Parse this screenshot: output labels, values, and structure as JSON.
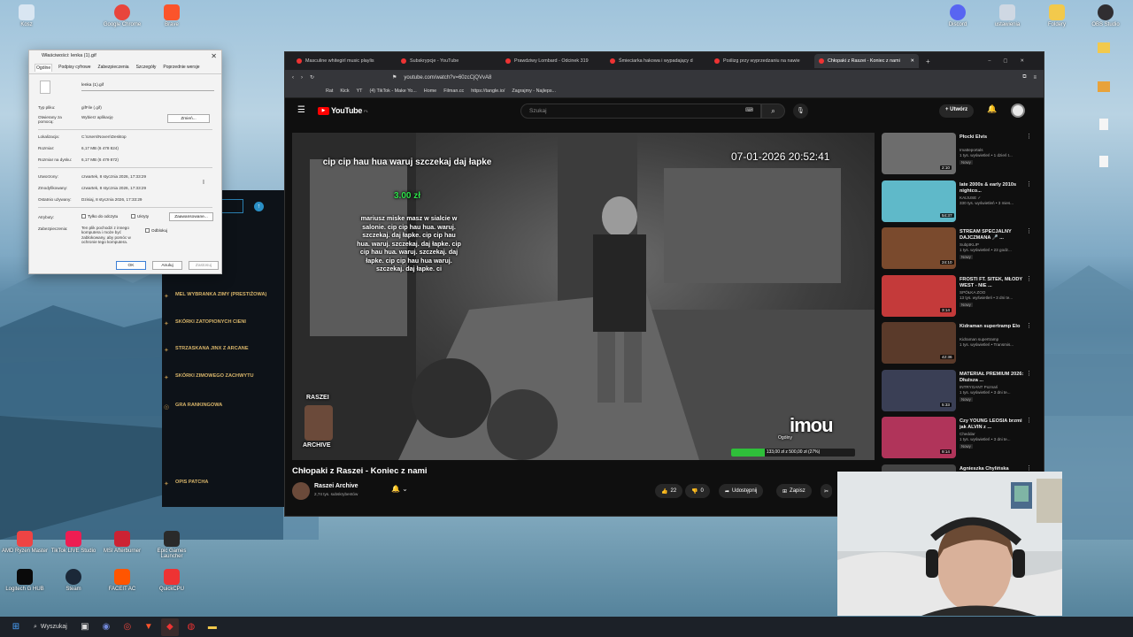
{
  "desktop": {
    "icons_left": [
      {
        "label": "Kosz",
        "color": "#d9e6f2"
      },
      {
        "label": "Google Chrome",
        "color": "#e8453c"
      },
      {
        "label": "Brave",
        "color": "#fb542b"
      }
    ],
    "icons_right": [
      {
        "label": "Discord",
        "color": "#5865f2"
      },
      {
        "label": "ustawienia",
        "color": "#cfd8e3"
      },
      {
        "label": "Foldery",
        "color": "#f2c94c"
      },
      {
        "label": "OBS Studio",
        "color": "#302e31"
      }
    ],
    "icons_bottom": [
      {
        "label": "AMD Ryzen Master",
        "color": "#e44"
      },
      {
        "label": "TikTok LIVE Studio",
        "color": "#ee1d52"
      },
      {
        "label": "MSI Afterburner",
        "color": "#c23"
      },
      {
        "label": "Epic Games Launcher",
        "color": "#2a2a2a"
      },
      {
        "label": "Logitech G HUB",
        "color": "#0a0a0a"
      },
      {
        "label": "Steam",
        "color": "#1b2838"
      },
      {
        "label": "FACEIT AC",
        "color": "#ff5500"
      },
      {
        "label": "QuickCPU",
        "color": "#e33"
      }
    ]
  },
  "taskbar": {
    "search_label": "Wyszukaj"
  },
  "properties_dialog": {
    "title": "Właściwości: lenka (1).gif",
    "close": "✕",
    "tabs": [
      "Ogólne",
      "Podpisy cyfrowe",
      "Zabezpieczenia",
      "Szczegóły",
      "Poprzednie wersje"
    ],
    "filename": "lenka (1).gif",
    "rows": [
      {
        "label": "Typ pliku:",
        "value": "gifFile (.gif)"
      },
      {
        "label": "Otwierany za pomocą:",
        "value": "Wybierz aplikację"
      },
      {
        "label": "Lokalizacja:",
        "value": "C:\\Users\\Noven\\Desktop"
      },
      {
        "label": "Rozmiar:",
        "value": "6,17 MB (6 478 824)"
      },
      {
        "label": "Rozmiar na dysku:",
        "value": "6,17 MB (6 479 872)"
      },
      {
        "label": "Utworzony:",
        "value": "czwartek, 8 stycznia 2026, 17:33:29"
      },
      {
        "label": "Zmodyfikowany:",
        "value": "czwartek, 8 stycznia 2026, 17:33:29"
      },
      {
        "label": "Ostatnio używany:",
        "value": "Dzisiaj, 8 stycznia 2026, 17:33:29"
      },
      {
        "label": "Atrybuty:",
        "value": ""
      },
      {
        "label": "Zabezpieczenia:",
        "value": "Ten plik pochodzi z innego komputera i może być zablokowany, aby pomóc w ochronie tego komputera."
      }
    ],
    "change_button": "Zmień...",
    "readonly_label": "Tylko do odczytu",
    "hidden_label": "Ukryty",
    "advanced_button": "Zaawansowane...",
    "unblock_label": "Odblokuj",
    "ok": "OK",
    "cancel": "Anuluj",
    "apply": "Zastosuj"
  },
  "launcher": {
    "menu": [
      "MEL WYBRANKA ZIMY (PRESTIŻOWA)",
      "SKÓRKI ZATOPIONYCH CIENI",
      "STRZASKANA JINX Z ARCANE",
      "SKÓRKI ZIMOWEGO ZACHWYTU",
      "GRA RANKINGOWA"
    ],
    "patch": "OPIS PATCHA"
  },
  "browser": {
    "tabs": [
      {
        "label": "Masculine whitegirl music playlis",
        "active": false
      },
      {
        "label": "Subskrypcje - YouTube",
        "active": false
      },
      {
        "label": "Prawdziwy Lombard - Odcinek 319",
        "active": false
      },
      {
        "label": "Śmieciarka hakowa i wypadający d",
        "active": false
      },
      {
        "label": "Poślizg przy wyprzedzaniu na nawie",
        "active": false
      },
      {
        "label": "Chłopaki z Raszei - Koniec z nami",
        "active": true
      }
    ],
    "new_tab": "+",
    "url": "youtube.com/watch?v=60zcCjQVvA8",
    "bookmarks": [
      "Rat",
      "Kick",
      "YT",
      "(4) TikTok - Make Yo...",
      "Home",
      "Filman.cc",
      "https://tangle.io/",
      "Zagrajmy - Najleps..."
    ]
  },
  "youtube": {
    "logo_text": "YouTube",
    "logo_region": "PL",
    "search_placeholder": "Szukaj",
    "create_label": "Utwórz",
    "video": {
      "overlay_title": "cip cip hau hua waruj szczekaj daj łapke",
      "overlay_amount": "3.00 zł",
      "overlay_message": "mariusz miske masz w sialcie w salonie. cip cip hau hua. waruj. szczekaj. daj łapke. cip cip hau hua. waruj. szczekaj. daj łapke. cip cip hau hua. waruj. szczekaj. daj łapke. cip cip hau hua waruj. szczekaj. daj łapke. ci",
      "timestamp": "07-01-2026 20:52:41",
      "watermark": "imou",
      "badge_name": "RASZEI",
      "badge_archive": "ARCHIVE",
      "goal_label": "Ogólny",
      "goal_text": "133,00 zł z 500,00 zł (27%)",
      "goal_fraction": 0.27
    },
    "title": "Chłopaki z Raszei - Koniec z nami",
    "channel": "Raszei Archive",
    "subscribers": "2,74 tys. subskrybentów",
    "likes": "22",
    "dislikes": "0",
    "share": "Udostępnij",
    "save": "Zapisz",
    "recommended": [
      {
        "title": "Płocki Elvis",
        "channel": "Imatteportals",
        "meta": "1 tys. wyświetleń • 1 dzień t...",
        "badge": "Nowy",
        "duration": "2:10",
        "color": "#6d6d6d"
      },
      {
        "title": "late 2000s & early 2010s nightco...",
        "channel": "KAIJUSE ✓",
        "meta": "330 tys. wyświetleń • 3 mies...",
        "badge": "",
        "duration": "54:37",
        "color": "#5fb9c9"
      },
      {
        "title": "STREAM SPECJALNY DAJCZMANA 🎤 ...",
        "channel": "SubptKLIP",
        "meta": "1 tys. wyświetleń • 23 godz...",
        "badge": "Nowy",
        "duration": "24:10",
        "color": "#7a4a2d"
      },
      {
        "title": "FROSTI FT. SITEK, MŁODY WEST - NIE ...",
        "channel": "SPÓŁKA ZOO",
        "meta": "13 tys. wyświetleń • 3 dni te...",
        "badge": "Nowy",
        "duration": "3:14",
        "color": "#c43a3a"
      },
      {
        "title": "Kidraman supertramp Elo",
        "channel": "Kidraman supertramp",
        "meta": "1 tys. wyświetleń • Transmis...",
        "badge": "",
        "duration": "42:36",
        "color": "#5a3a2a"
      },
      {
        "title": "MATERIAŁ PREMIUM 2026: Dłuższa ...",
        "channel": "INTRYGANT Poznań",
        "meta": "1 tys. wyświetleń • 3 dni te...",
        "badge": "Nowy",
        "duration": "5:33",
        "color": "#3a3f55"
      },
      {
        "title": "Czy YOUNG LEOSIA brzmi jak ALVIN z ...",
        "channel": "Cheddar",
        "meta": "1 tys. wyświetleń • 3 dni te...",
        "badge": "Nowy",
        "duration": "9:14",
        "color": "#b0345a"
      },
      {
        "title": "Agnieszka Chylińska",
        "channel": "",
        "meta": "",
        "badge": "",
        "duration": "",
        "color": "#444"
      }
    ]
  }
}
